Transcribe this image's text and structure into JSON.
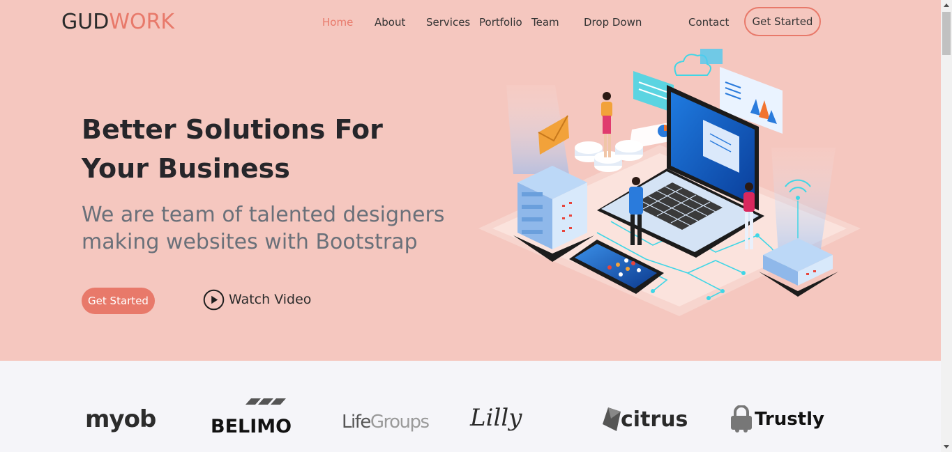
{
  "brand": {
    "part1": "GUD",
    "part2": "WORK"
  },
  "nav": {
    "home": "Home",
    "about": "About",
    "services": "Services",
    "portfolio": "Portfolio",
    "team": "Team",
    "dropdown": "Drop Down",
    "contact": "Contact"
  },
  "header_button": "Get Started",
  "hero": {
    "title_line1": "Better Solutions For",
    "title_line2": "Your Business",
    "subtitle_line1": "We are team of talented designers",
    "subtitle_line2": "making websites with Bootstrap",
    "cta_label": "Get Started",
    "watch_label": "Watch Video"
  },
  "clients": {
    "myob": "myob",
    "belimo": "BELIMO",
    "lifegroups_a": "Life",
    "lifegroups_b": "Groups",
    "lilly": "Lilly",
    "citrus": "citrus",
    "trustly": "Trustly"
  },
  "colors": {
    "accent": "#e8796a",
    "hero_bg": "#f5c7bf",
    "clients_bg": "#f5f5f9",
    "title": "#26262a",
    "subtitle": "#6a7079"
  },
  "icons": {
    "play": "play-circle-icon",
    "scroll_up": "triangle-up-icon",
    "scroll_down": "triangle-down-icon"
  }
}
